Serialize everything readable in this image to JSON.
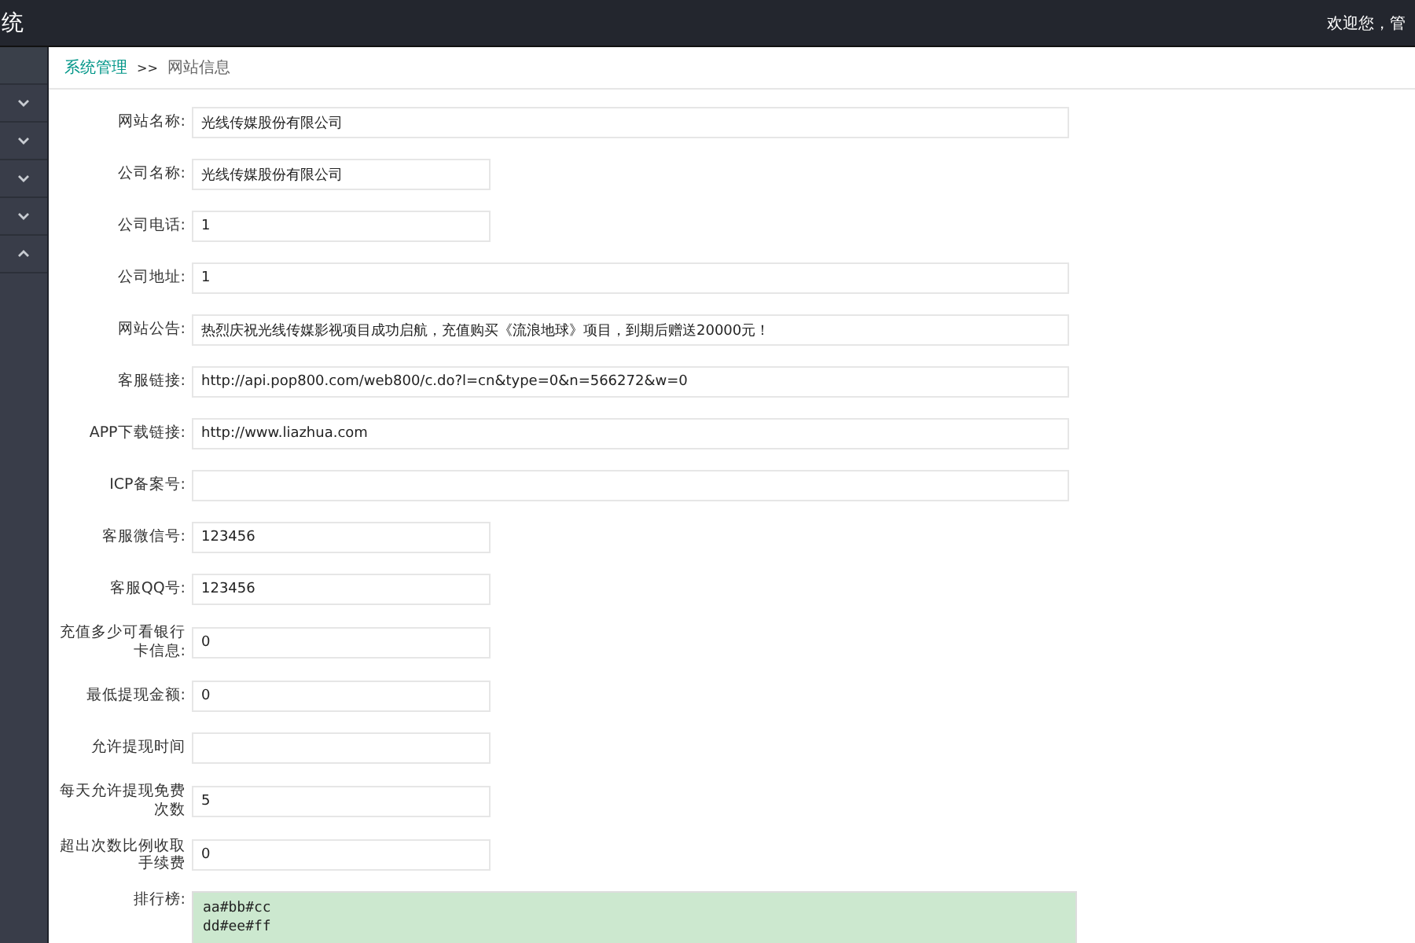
{
  "header": {
    "title": "统",
    "welcome": "欢迎您，管"
  },
  "sidebar": {
    "items": [
      {
        "expanded": false
      },
      {
        "expanded": false
      },
      {
        "expanded": false
      },
      {
        "expanded": false
      },
      {
        "expanded": true
      }
    ]
  },
  "breadcrumb": {
    "parent": "系统管理",
    "separator": ">>",
    "current": "网站信息"
  },
  "fields": [
    {
      "label": "网站名称:",
      "value": "光线传媒股份有限公司",
      "kind": "wide"
    },
    {
      "label": "公司名称:",
      "value": "光线传媒股份有限公司",
      "kind": "narrow"
    },
    {
      "label": "公司电话:",
      "value": "1",
      "kind": "narrow"
    },
    {
      "label": "公司地址:",
      "value": "1",
      "kind": "wide"
    },
    {
      "label": "网站公告:",
      "value": "热烈庆祝光线传媒影视项目成功启航，充值购买《流浪地球》项目，到期后赠送20000元！",
      "kind": "wide"
    },
    {
      "label": "客服链接:",
      "value": "http://api.pop800.com/web800/c.do?l=cn&type=0&n=566272&w=0",
      "kind": "wide"
    },
    {
      "label": "APP下载链接:",
      "value": "http://www.liazhua.com",
      "kind": "wide"
    },
    {
      "label": "ICP备案号:",
      "kind": "wide"
    },
    {
      "label": "客服微信号:",
      "value": "123456",
      "kind": "narrow"
    },
    {
      "label": "客服QQ号:",
      "value": "123456",
      "kind": "narrow"
    },
    {
      "label": "充值多少可看银行卡信息:",
      "value": "0",
      "kind": "narrow"
    },
    {
      "label": "最低提现金额:",
      "value": "0",
      "kind": "narrow"
    },
    {
      "label": "允许提现时间",
      "kind": "narrow"
    },
    {
      "label": "每天允许提现免费次数",
      "value": "5",
      "kind": "narrow"
    },
    {
      "label": "超出次数比例收取手续费",
      "value": "0",
      "kind": "narrow"
    }
  ],
  "ranking": {
    "label": "排行榜:",
    "value": "aa#bb#cc\ndd#ee#ff"
  }
}
